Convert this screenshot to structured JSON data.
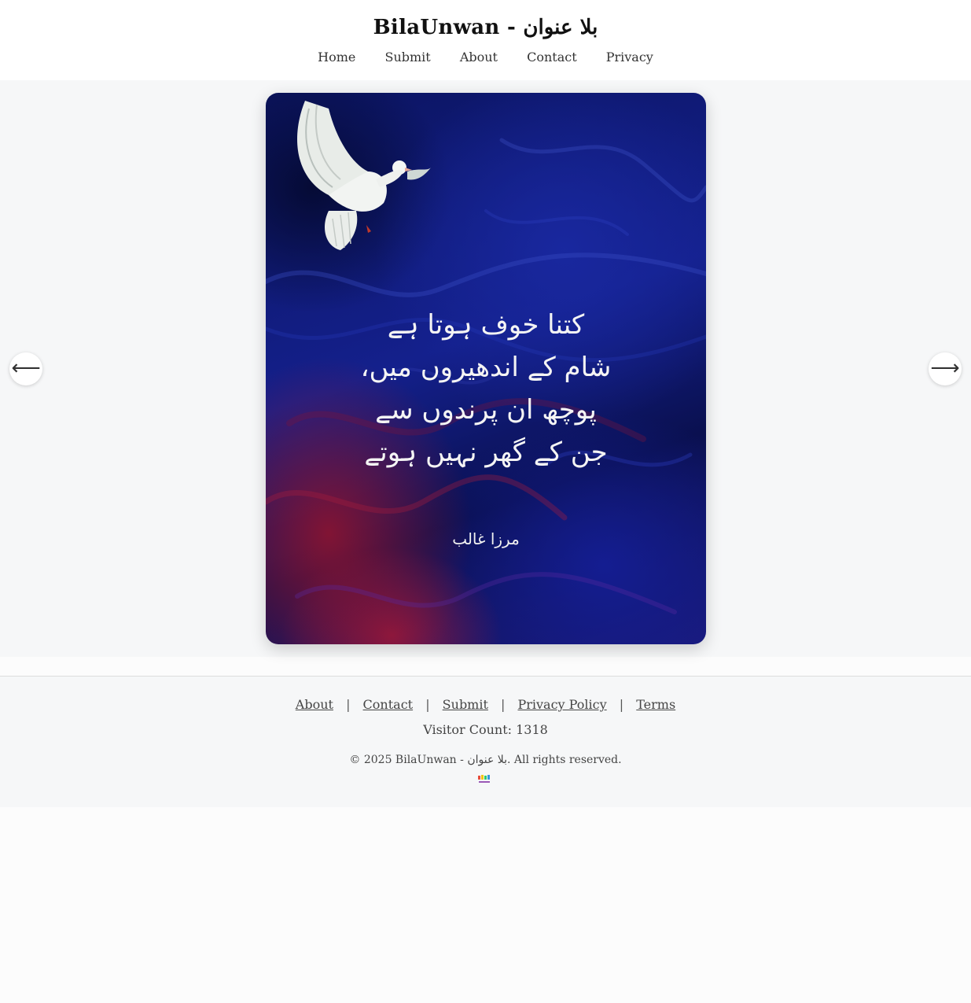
{
  "header": {
    "site_title": "BilaUnwan - بلا عنوان",
    "nav": [
      "Home",
      "Submit",
      "About",
      "Contact",
      "Privacy"
    ]
  },
  "carousel": {
    "prev_arrow": "⟵",
    "next_arrow": "⟶",
    "card": {
      "poem_lines": [
        "کتنا خوف ہوتا ہے",
        "شام کے اندھیروں میں،",
        "پوچھ ان پرندوں سے",
        "جن کے گھر نہیں ہوتے"
      ],
      "poet": "مرزا غالب"
    }
  },
  "footer": {
    "links": [
      "About",
      "Contact",
      "Submit",
      "Privacy Policy",
      "Terms"
    ],
    "separator": "|",
    "visitor_count": "Visitor Count: 1318",
    "copyright": "© 2025 BilaUnwan - بلا عنوان. All rights reserved."
  },
  "icons": {
    "prev": "arrow-left-icon",
    "next": "arrow-right-icon",
    "dove": "dove-image",
    "footer_logo": "site-logo-icon"
  }
}
